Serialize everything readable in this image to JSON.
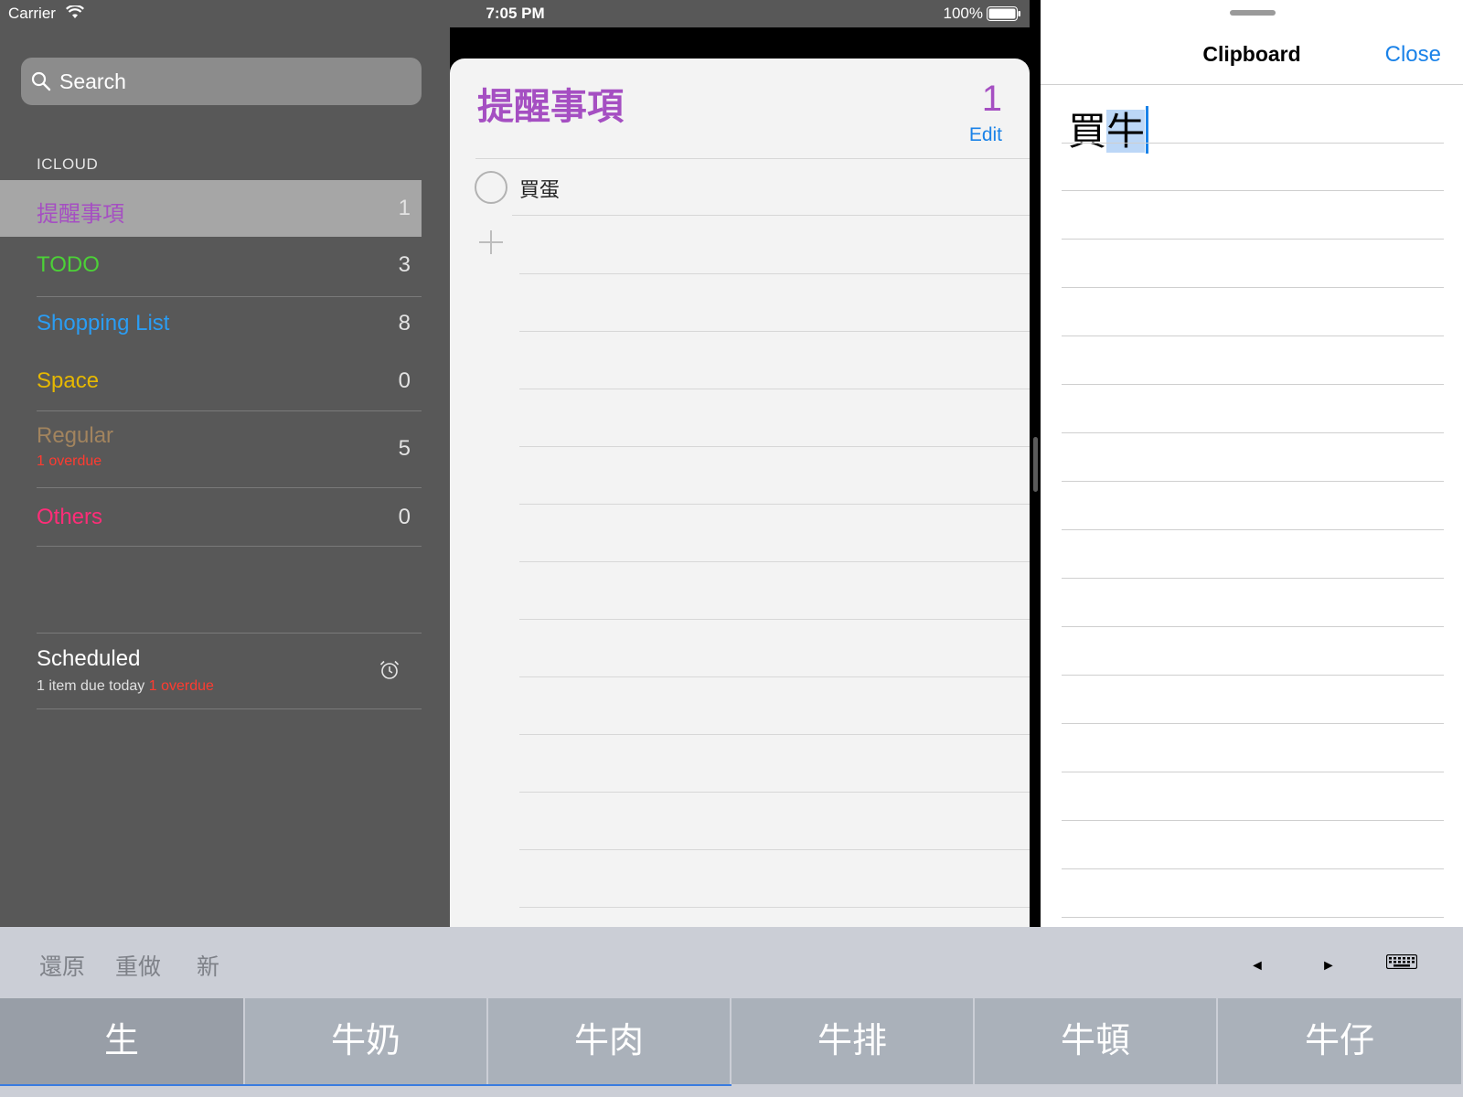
{
  "status_bar": {
    "carrier": "Carrier",
    "time": "7:05 PM",
    "battery": "100%"
  },
  "sidebar": {
    "search_placeholder": "Search",
    "section": "ICLOUD",
    "lists": [
      {
        "name": "提醒事項",
        "count": "1",
        "color": "#a54fc2"
      },
      {
        "name": "TODO",
        "count": "3",
        "color": "#4cd137"
      },
      {
        "name": "Shopping List",
        "count": "8",
        "color": "#2a9df4"
      },
      {
        "name": "Space",
        "count": "0",
        "color": "#e6b800"
      },
      {
        "name": "Regular",
        "count": "5",
        "sub": "1 overdue",
        "color": "#a2845e"
      },
      {
        "name": "Others",
        "count": "0",
        "color": "#ff2d78"
      }
    ],
    "scheduled": {
      "title": "Scheduled",
      "subtitle": "1 item due today",
      "overdue": "1 overdue",
      "icon": "alarm-clock-icon"
    }
  },
  "reminders": {
    "title": "提醒事項",
    "count": "1",
    "edit": "Edit",
    "items": [
      {
        "text": "買蛋",
        "completed": false
      }
    ]
  },
  "clipboard": {
    "title": "Clipboard",
    "close": "Close",
    "text_plain": "買",
    "text_marked": "牛"
  },
  "keyboard_toolbar": {
    "undo": "還原",
    "redo": "重做",
    "new": "新",
    "left_arrow": "◄",
    "right_arrow": "►",
    "hide_keyboard_icon": "keyboard-icon"
  },
  "candidates": [
    "生",
    "牛奶",
    "牛肉",
    "牛排",
    "牛頓",
    "牛仔"
  ],
  "colors": {
    "accent_blue": "#1a82e8",
    "reminders_purple": "#a54fc2",
    "overdue_red": "#ff3b30"
  }
}
